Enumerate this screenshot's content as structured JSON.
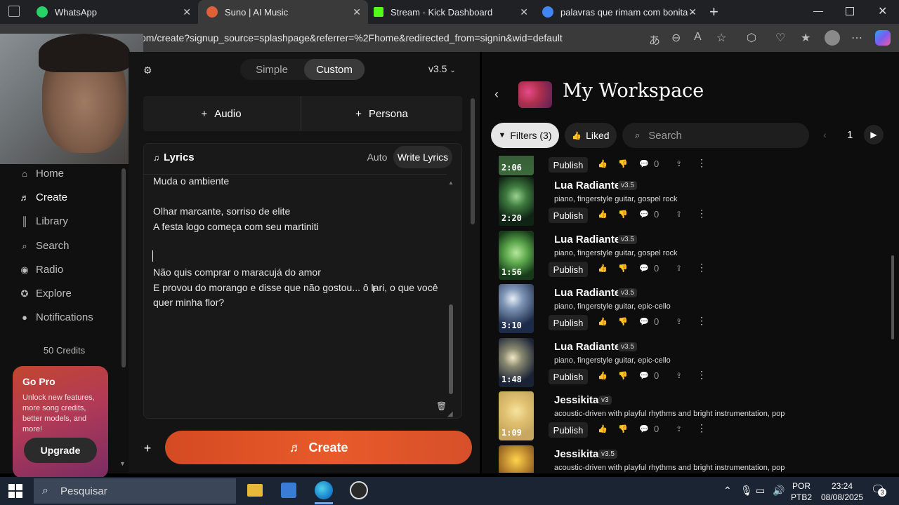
{
  "browser": {
    "tabs": [
      {
        "title": "WhatsApp",
        "favicon_color": "#25d366"
      },
      {
        "title": "Suno | AI Music",
        "favicon_color": "#e0603a"
      },
      {
        "title": "Stream - Kick Dashboard",
        "favicon_color": "#53fc18"
      },
      {
        "title": "palavras que rimam com bonita -",
        "favicon_color": "#4285f4"
      }
    ],
    "url": "om/create?signup_source=splashpage&referrer=%2Fhome&redirected_from=signin&wid=default"
  },
  "sidebar": {
    "items": [
      {
        "label": "Home",
        "icon": "home-icon"
      },
      {
        "label": "Create",
        "icon": "create-icon"
      },
      {
        "label": "Library",
        "icon": "library-icon"
      },
      {
        "label": "Search",
        "icon": "search-icon"
      },
      {
        "label": "Radio",
        "icon": "radio-icon"
      },
      {
        "label": "Explore",
        "icon": "explore-icon"
      },
      {
        "label": "Notifications",
        "icon": "bell-icon"
      }
    ],
    "credits": "50 Credits",
    "gopro": {
      "title": "Go Pro",
      "desc": "Unlock new features, more song credits, better models, and more!",
      "button": "Upgrade"
    }
  },
  "create": {
    "modes": {
      "simple": "Simple",
      "custom": "Custom"
    },
    "version": "v3.5",
    "audio_label": "Audio",
    "persona_label": "Persona",
    "lyrics_title": "Lyrics",
    "auto_label": "Auto",
    "write_label": "Write Lyrics",
    "lyrics_lines": [
      "Muda o ambiente",
      "",
      "Olhar marcante, sorriso de elite",
      "A festa logo começa com seu martiniti",
      "",
      "",
      "Não quis comprar o maracujá do amor",
      "E provou do morango e disse que não gostou... ô lari, o que você",
      "quer minha flor?"
    ],
    "create_button": "Create"
  },
  "workspace": {
    "title": "My Workspace",
    "filters_label": "Filters (3)",
    "liked_label": "Liked",
    "search_placeholder": "Search",
    "page": "1",
    "publish_label": "Publish",
    "songs": [
      {
        "title": "",
        "version": "",
        "tags": "",
        "duration": "2:06",
        "count": "0"
      },
      {
        "title": "Lua Radiante",
        "version": "v3.5",
        "tags": "piano, fingerstyle guitar, gospel rock",
        "duration": "2:20",
        "count": "0"
      },
      {
        "title": "Lua Radiante",
        "version": "v3.5",
        "tags": "piano, fingerstyle guitar, gospel rock",
        "duration": "1:56",
        "count": "0"
      },
      {
        "title": "Lua Radiante",
        "version": "v3.5",
        "tags": "piano, fingerstyle guitar, epic-cello",
        "duration": "3:10",
        "count": "0"
      },
      {
        "title": "Lua Radiante",
        "version": "v3.5",
        "tags": "piano, fingerstyle guitar, epic-cello",
        "duration": "1:48",
        "count": "0"
      },
      {
        "title": "Jessikita",
        "version": "v3",
        "tags": "acoustic-driven with playful rhythms and bright instrumentation, pop",
        "duration": "1:09",
        "count": "0"
      },
      {
        "title": "Jessikita",
        "version": "v3.5",
        "tags": "acoustic-driven with playful rhythms and bright instrumentation, pop",
        "duration": "",
        "count": ""
      }
    ]
  },
  "taskbar": {
    "search_placeholder": "Pesquisar",
    "lang_1": "POR",
    "lang_2": "PTB2",
    "time": "23:24",
    "date": "08/08/2025",
    "notif_count": "3"
  },
  "colors": {
    "create_button": "#e0552a",
    "background": "#101010"
  }
}
